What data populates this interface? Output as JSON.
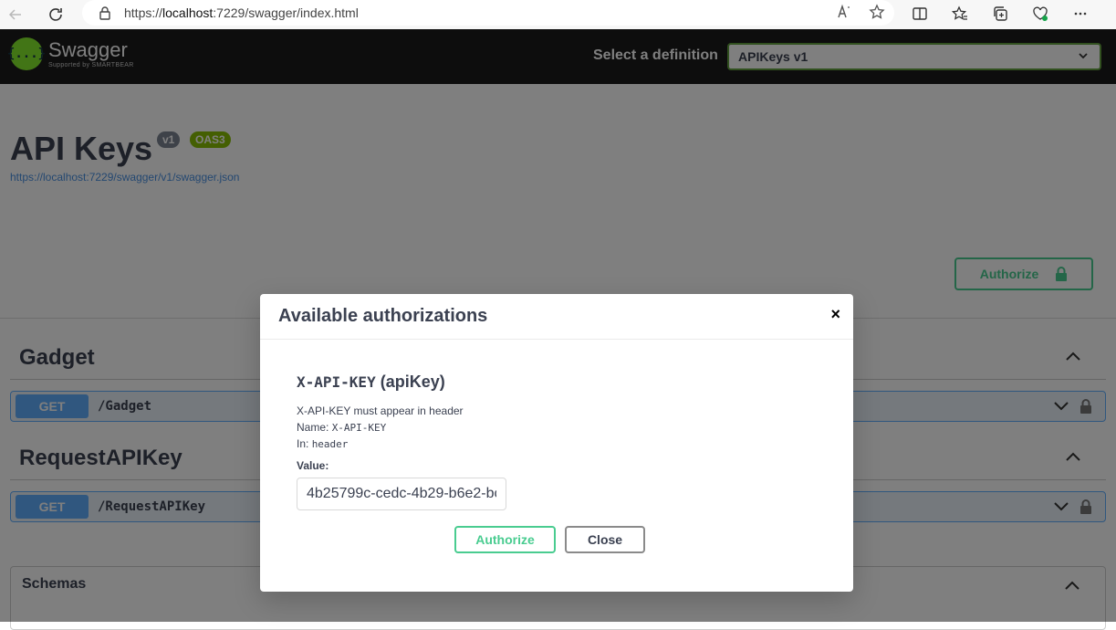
{
  "browser": {
    "url_prefix": "https://",
    "url_host": "localhost",
    "url_rest": ":7229/swagger/index.html"
  },
  "swagger": {
    "logo_title": "Swagger",
    "logo_sub": "Supported by SMARTBEAR",
    "logo_glyph": "{...}",
    "definition_label": "Select a definition",
    "definition_value": "APIKeys v1"
  },
  "api": {
    "title": "API Keys",
    "version_badge": "v1",
    "oas_badge": "OAS3",
    "spec_url": "https://localhost:7229/swagger/v1/swagger.json",
    "authorize_label": "Authorize"
  },
  "tags": [
    {
      "name": "Gadget",
      "method": "GET",
      "path": "/Gadget"
    },
    {
      "name": "RequestAPIKey",
      "method": "GET",
      "path": "/RequestAPIKey"
    }
  ],
  "schemas_label": "Schemas",
  "modal": {
    "title": "Available authorizations",
    "close_glyph": "×",
    "scheme_code": "X-API-KEY",
    "scheme_type": "(apiKey)",
    "description": "X-API-KEY must appear in header",
    "name_label": "Name:",
    "name_value": "X-API-KEY",
    "in_label": "In:",
    "in_value": "header",
    "value_label": "Value:",
    "value_input": "4b25799c-cedc-4b29-b6e2-bc",
    "authorize_button": "Authorize",
    "close_button": "Close"
  },
  "colors": {
    "accent_green": "#49cc90",
    "get_blue": "#61affe",
    "topbar": "#1b1b1b"
  }
}
